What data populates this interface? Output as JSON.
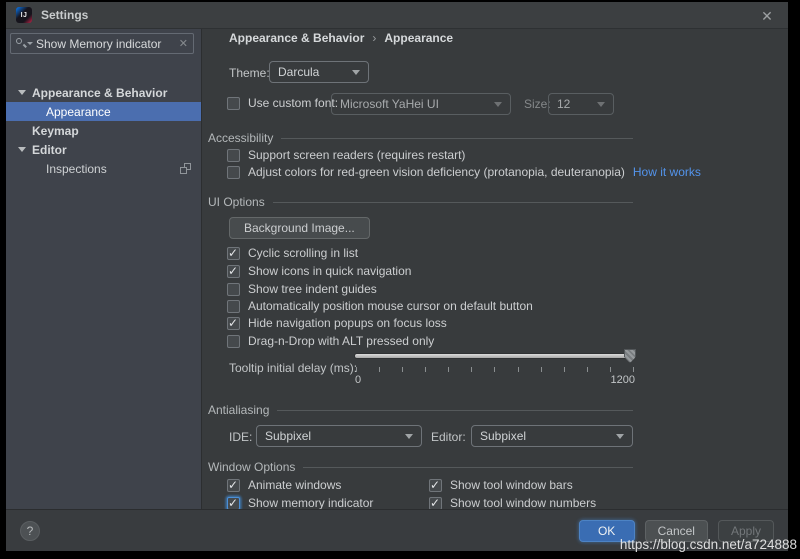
{
  "window": {
    "title": "Settings",
    "close_glyph": "✕"
  },
  "sidebar": {
    "search_value": "Show Memory indicator",
    "clear_glyph": "✕",
    "tree": [
      {
        "label": "Appearance & Behavior",
        "type": "group",
        "expanded": true
      },
      {
        "label": "Appearance",
        "type": "child",
        "selected": true
      },
      {
        "label": "Keymap",
        "type": "group",
        "expanded": false
      },
      {
        "label": "Editor",
        "type": "group",
        "expanded": true
      },
      {
        "label": "Inspections",
        "type": "child",
        "selected": false
      }
    ]
  },
  "main": {
    "breadcrumb": {
      "parent": "Appearance & Behavior",
      "separator": "›",
      "current": "Appearance"
    },
    "theme": {
      "label": "Theme:",
      "value": "Darcula"
    },
    "custom_font": {
      "label": "Use custom font:",
      "checked": false,
      "font": "Microsoft YaHei UI",
      "size_label": "Size:",
      "size": "12"
    },
    "accessibility": {
      "title": "Accessibility",
      "screen_readers": {
        "label": "Support screen readers (requires restart)",
        "checked": false
      },
      "red_green": {
        "label": "Adjust colors for red-green vision deficiency (protanopia, deuteranopia)",
        "checked": false
      },
      "link": "How it works"
    },
    "ui_options": {
      "title": "UI Options",
      "background_image_button": "Background Image...",
      "checkboxes": [
        {
          "label": "Cyclic scrolling in list",
          "checked": true
        },
        {
          "label": "Show icons in quick navigation",
          "checked": true
        },
        {
          "label": "Show tree indent guides",
          "checked": false
        },
        {
          "label": "Automatically position mouse cursor on default button",
          "checked": false
        },
        {
          "label": "Hide navigation popups on focus loss",
          "checked": true
        },
        {
          "label": "Drag-n-Drop with ALT pressed only",
          "checked": false
        }
      ],
      "slider": {
        "label": "Tooltip initial delay (ms):",
        "min": 0,
        "max": 1200,
        "value": 1200,
        "min_label": "0",
        "max_label": "1200",
        "tick_count": 13
      }
    },
    "antialiasing": {
      "title": "Antialiasing",
      "ide_label": "IDE:",
      "ide_value": "Subpixel",
      "editor_label": "Editor:",
      "editor_value": "Subpixel"
    },
    "window_options": {
      "title": "Window Options",
      "col1": [
        {
          "label": "Animate windows",
          "checked": true,
          "focused": false
        },
        {
          "label": "Show memory indicator",
          "checked": true,
          "focused": true
        }
      ],
      "col2": [
        {
          "label": "Show tool window bars",
          "checked": true
        },
        {
          "label": "Show tool window numbers",
          "checked": true
        }
      ]
    }
  },
  "footer": {
    "help": "?",
    "ok": "OK",
    "cancel": "Cancel",
    "apply": "Apply"
  },
  "watermark": "https://blog.csdn.net/a724888",
  "colors": {
    "selection": "#4b6eaf",
    "link": "#5394ec",
    "ok_button": "#3a6db3",
    "panel": "#383b3d",
    "sidebar": "#3f434b",
    "title_bar": "#3c3f41"
  }
}
